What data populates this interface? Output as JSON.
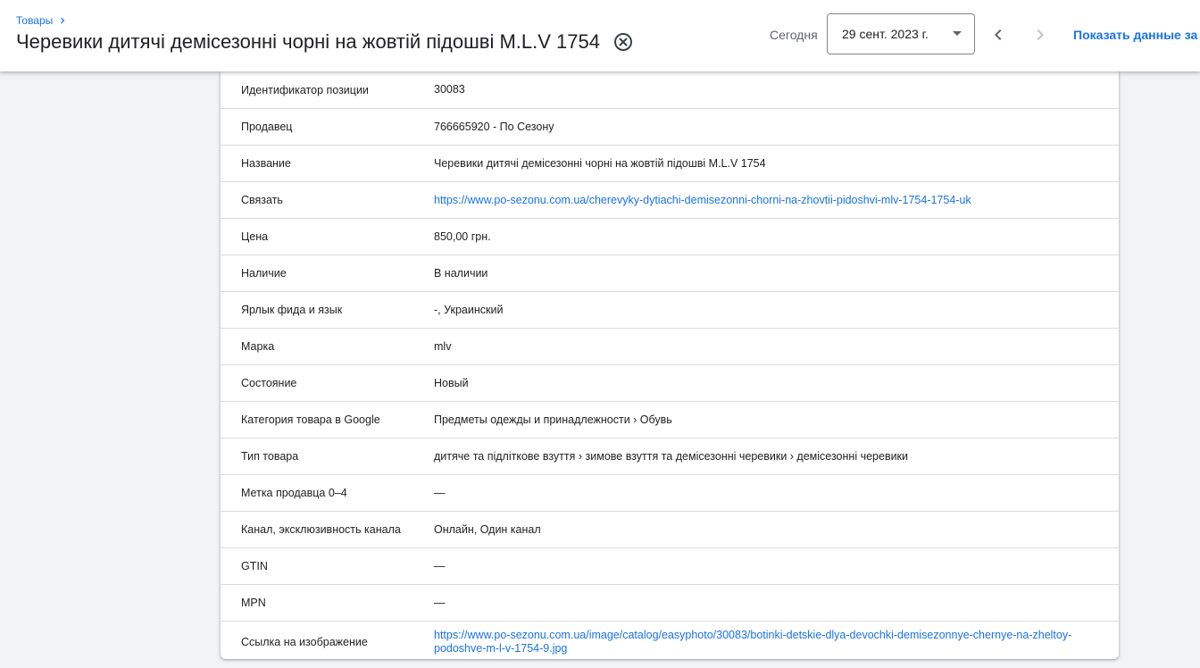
{
  "header": {
    "breadcrumb": "Товары",
    "title": "Черевики дитячі демісезонні чорні на жовтій підошві M.L.V 1754",
    "today_label": "Сегодня",
    "date_value": "29 сент. 2023 г.",
    "show_data_label": "Показать данные за п"
  },
  "details": [
    {
      "label": "Идентификатор позиции",
      "value": "30083"
    },
    {
      "label": "Продавец",
      "value": "766665920 - По Сезону"
    },
    {
      "label": "Название",
      "value": "Черевики дитячі демісезонні чорні на жовтій підошві M.L.V 1754"
    },
    {
      "label": "Связать",
      "value": "https://www.po-sezonu.com.ua/cherevyky-dytiachi-demisezonni-chorni-na-zhovtii-pidoshvi-mlv-1754-1754-uk"
    },
    {
      "label": "Цена",
      "value": "850,00 грн."
    },
    {
      "label": "Наличие",
      "value": "В наличии"
    },
    {
      "label": "Ярлык фида и язык",
      "value": "-, Украинский"
    },
    {
      "label": "Марка",
      "value": "mlv"
    },
    {
      "label": "Состояние",
      "value": "Новый"
    },
    {
      "label": "Категория товара в Google",
      "value": "Предметы одежды и принадлежности › Обувь"
    },
    {
      "label": "Тип товара",
      "value": "дитяче та підліткове взуття › зимове взуття та демісезонні черевики › демісезонні черевики"
    },
    {
      "label": "Метка продавца 0–4",
      "value": "—"
    },
    {
      "label": "Канал, эксклюзивность канала",
      "value": "Онлайн, Один канал"
    },
    {
      "label": "GTIN",
      "value": "—"
    },
    {
      "label": "MPN",
      "value": "—"
    },
    {
      "label": "Ссылка на изображение",
      "value": "https://www.po-sezonu.com.ua/image/catalog/easyphoto/30083/botinki-detskie-dlya-devochki-demisezonnye-chernye-na-zheltoy-podoshve-m-l-v-1754-9.jpg"
    }
  ],
  "icons": {
    "breadcrumb_separator": "chevron-right-icon",
    "clear": "cancel-circle-icon",
    "date_dropdown": "caret-down-icon",
    "prev": "chevron-left-icon",
    "next": "chevron-right-icon"
  },
  "colors": {
    "accent": "#1a73e8",
    "background": "#f1f3f4",
    "divider": "#dadce0"
  }
}
